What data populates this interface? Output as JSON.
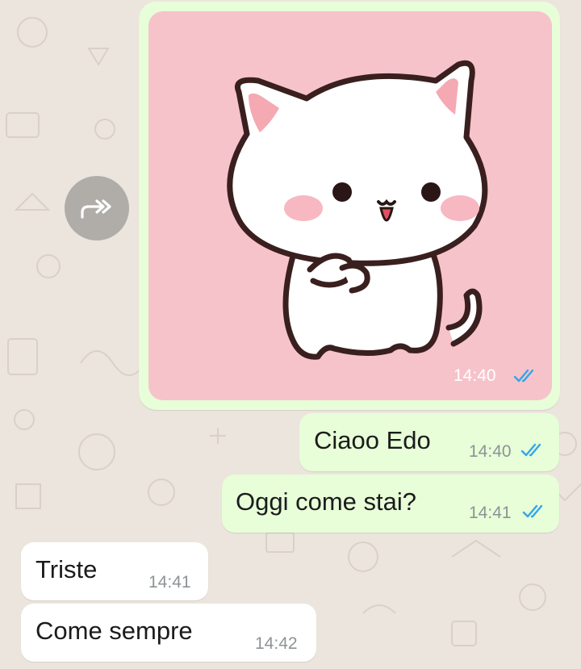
{
  "colors": {
    "chat_background": "#ece5dd",
    "outgoing_bubble": "#e7fed8",
    "incoming_bubble": "#ffffff",
    "read_ticks": "#34a6e8",
    "sticker_background": "#f6c3cb"
  },
  "messages": [
    {
      "direction": "outgoing",
      "type": "sticker",
      "sticker": "white-cat-sticker",
      "time": "14:40",
      "status": "read"
    },
    {
      "direction": "outgoing",
      "type": "text",
      "text": "Ciaoo Edo",
      "time": "14:40",
      "status": "read"
    },
    {
      "direction": "outgoing",
      "type": "text",
      "text": "Oggi come stai?",
      "time": "14:41",
      "status": "read"
    },
    {
      "direction": "incoming",
      "type": "text",
      "text": "Triste",
      "time": "14:41"
    },
    {
      "direction": "incoming",
      "type": "text",
      "text": "Come sempre",
      "time": "14:42"
    }
  ],
  "icons": {
    "forward": "forward-icon",
    "read_receipt": "double-check-icon"
  }
}
